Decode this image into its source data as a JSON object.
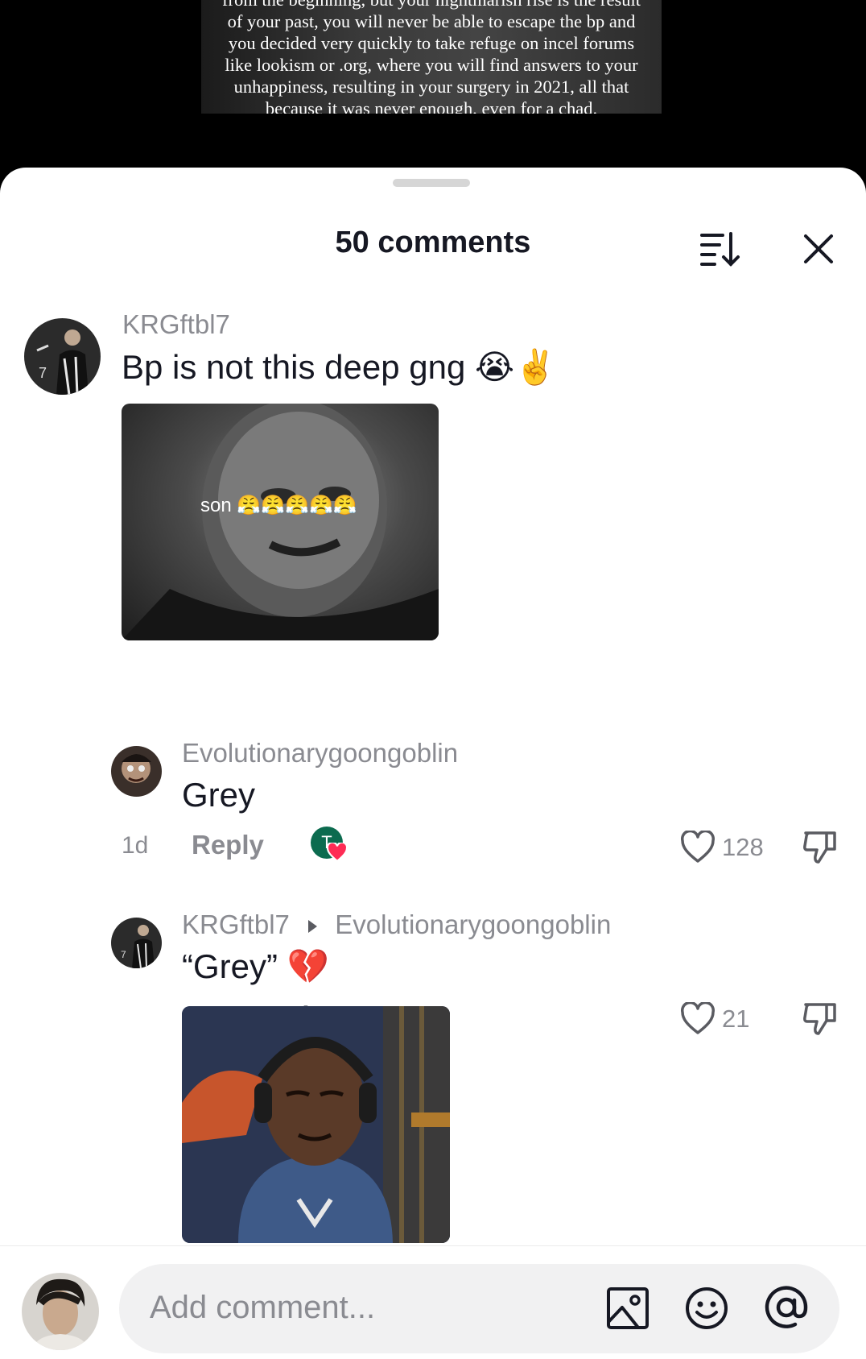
{
  "video": {
    "caption_lines": [
      "from the beginning, but your nightmarish rise is the result",
      "of your past, you will never be able to escape the bp and",
      "you decided very quickly to take refuge on incel forums",
      "like lookism or .org, where you will find answers to your",
      "unhappiness, resulting in your surgery in 2021, all that",
      "because it was never enough, even for a chad."
    ]
  },
  "sheet": {
    "title": "50 comments",
    "sort_icon": "sort-icon",
    "close_icon": "close-icon"
  },
  "comments": [
    {
      "username": "KRGftbl7",
      "text": "Bp is not this deep gng 😭✌️",
      "media_caption": "son 😤😤😤😤😤",
      "time": "1d",
      "reply_label": "Reply",
      "creator_liked_initial": "T",
      "likes": "128"
    },
    {
      "username": "Evolutionarygoongoblin",
      "text": "Grey",
      "time": "1d",
      "reply_label": "Reply",
      "likes": "21"
    },
    {
      "username": "KRGftbl7",
      "reply_to": "Evolutionarygoongoblin",
      "text": "“Grey” 💔"
    }
  ],
  "composer": {
    "placeholder": "Add comment...",
    "icons": [
      "image-icon",
      "emoji-icon",
      "mention-icon"
    ]
  },
  "colors": {
    "secondary_text": "#8a8b91",
    "primary_text": "#161823",
    "like_heart_badge": "#fe2c55",
    "creator_badge_bg": "#0c6b4f"
  }
}
